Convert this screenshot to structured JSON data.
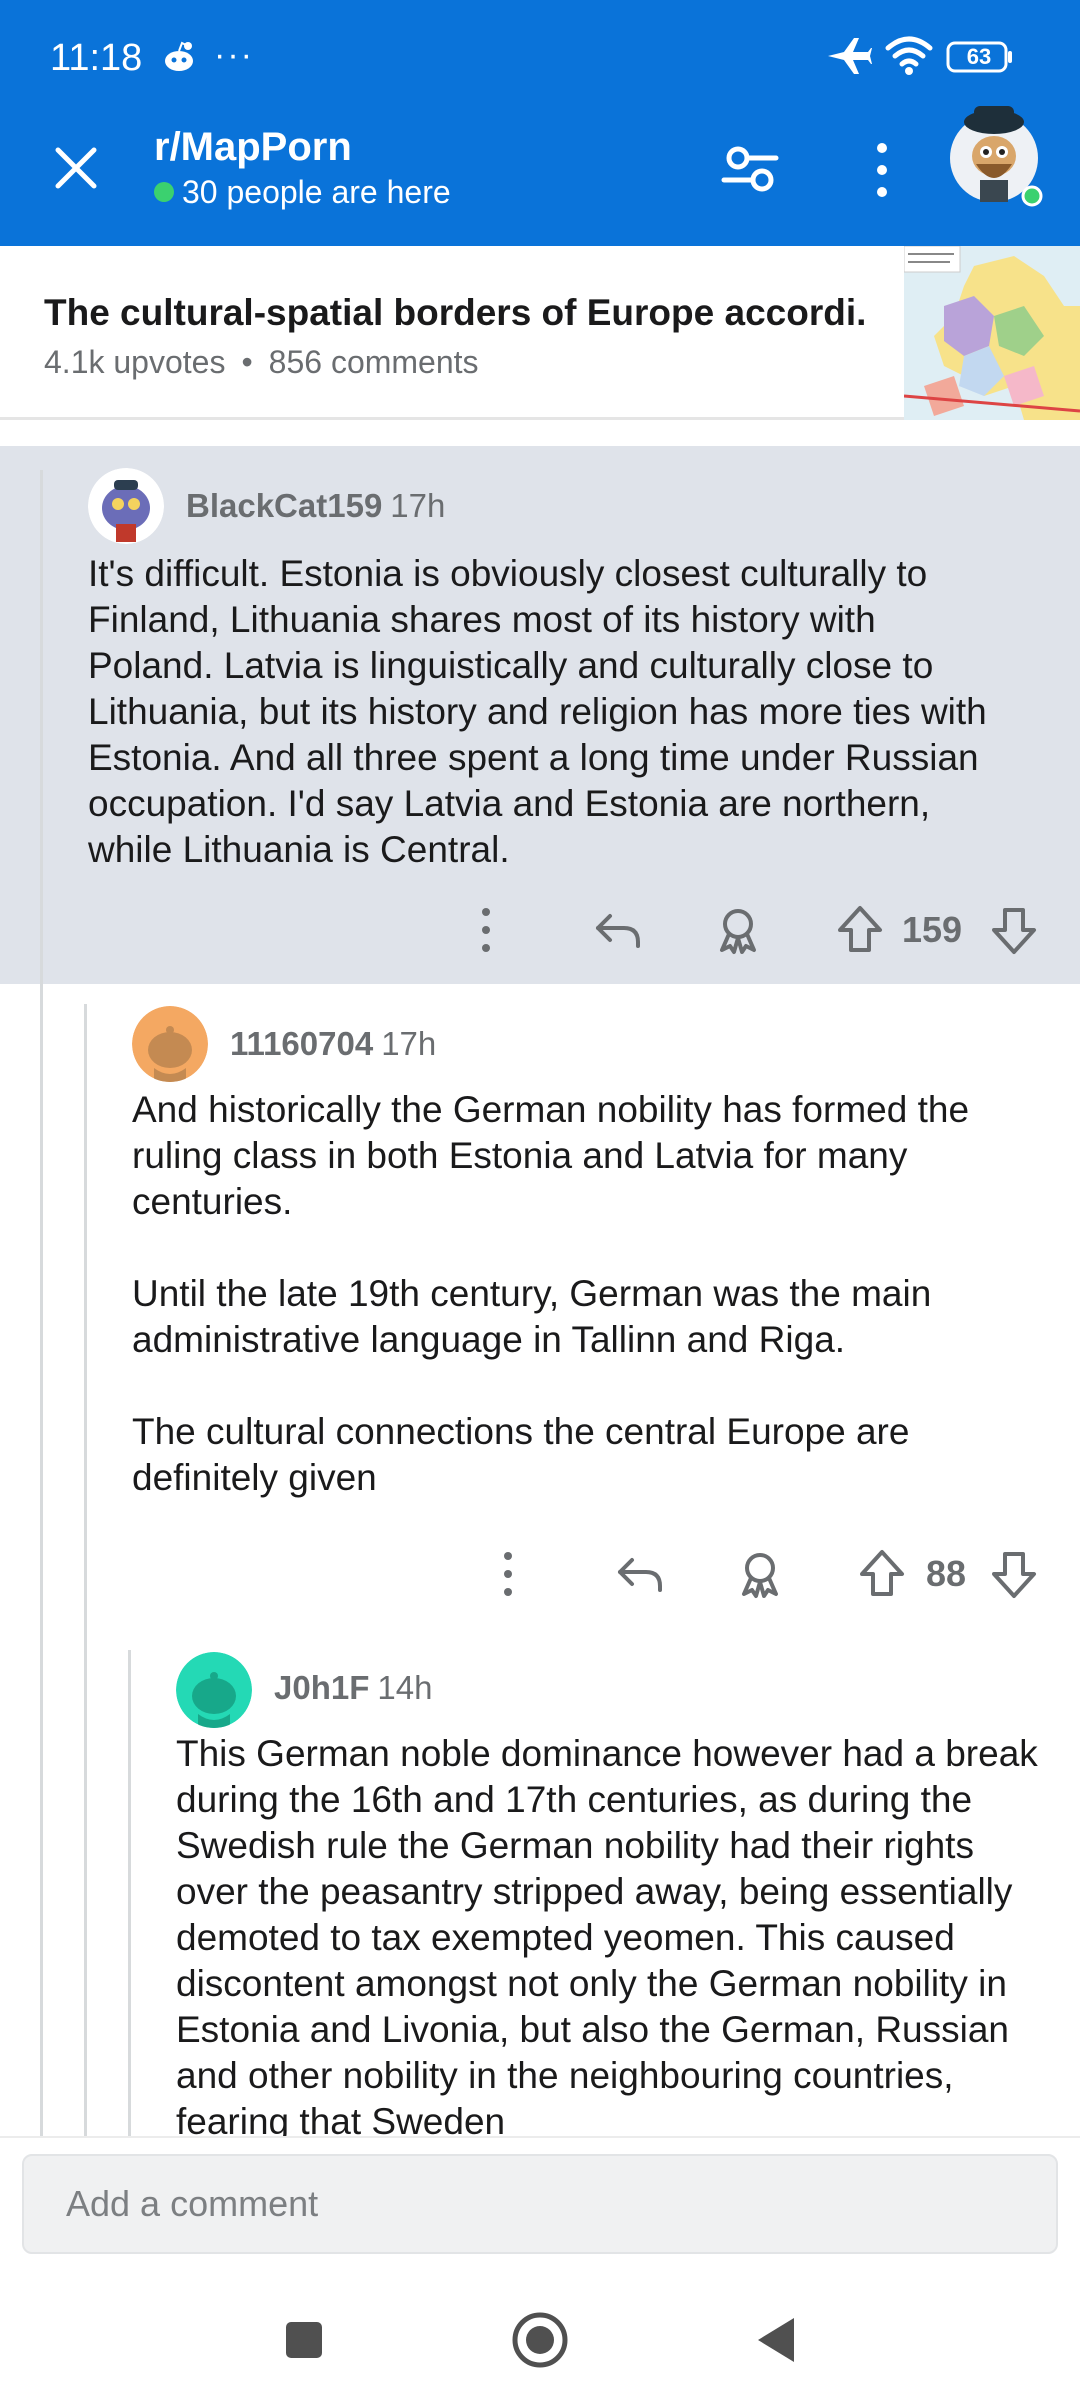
{
  "status_bar": {
    "time": "11:18",
    "dots": "···",
    "battery": "63"
  },
  "app_bar": {
    "subreddit": "r/MapPorn",
    "online_text": "30 people are here",
    "online_color": "#3bd16f",
    "bar_color": "#0a73d9"
  },
  "post": {
    "title": "The cultural-spatial borders of Europe accordi...",
    "upvotes": "4.1k upvotes",
    "separator": "•",
    "comments": "856 comments"
  },
  "comments": [
    {
      "author": "BlackCat159",
      "age": "17h",
      "body": [
        "It's difficult. Estonia is obviously closest culturally to Finland, Lithuania shares most of its history with Poland. Latvia is linguistically and culturally close to Lithuania, but its history and religion has more ties with Estonia. And all three spent a long time under Russian occupation. I'd say Latvia and Estonia are northern, while Lithuania is Central."
      ],
      "votes": "159"
    },
    {
      "author": "11160704",
      "age": "17h",
      "body": [
        "And historically the German nobility has formed the ruling class in both Estonia and Latvia for many centuries.",
        "Until the late 19th century, German was the main administrative language in Tallinn and Riga.",
        "The cultural connections the central Europe are definitely given"
      ],
      "votes": "88"
    },
    {
      "author": "J0h1F",
      "age": "14h",
      "body": [
        "This German noble dominance however had a break during the 16th and 17th centuries, as during the Swedish rule the German nobility had their rights over the peasantry stripped away, being essentially demoted to tax exempted yeomen. This caused discontent amongst not only the German nobility in Estonia and Livonia, but also the German, Russian and other nobility in the neighbouring countries, fearing that Sweden"
      ]
    }
  ],
  "comment_input": {
    "placeholder": "Add a comment"
  },
  "icons": {
    "close": "close-icon",
    "filter": "filter-icon",
    "more": "more-vertical-icon",
    "reply": "reply-icon",
    "award": "award-icon",
    "upvote": "upvote-icon",
    "downvote": "downvote-icon",
    "nav_recents": "square-icon",
    "nav_home": "circle-icon",
    "nav_back": "triangle-back-icon"
  }
}
